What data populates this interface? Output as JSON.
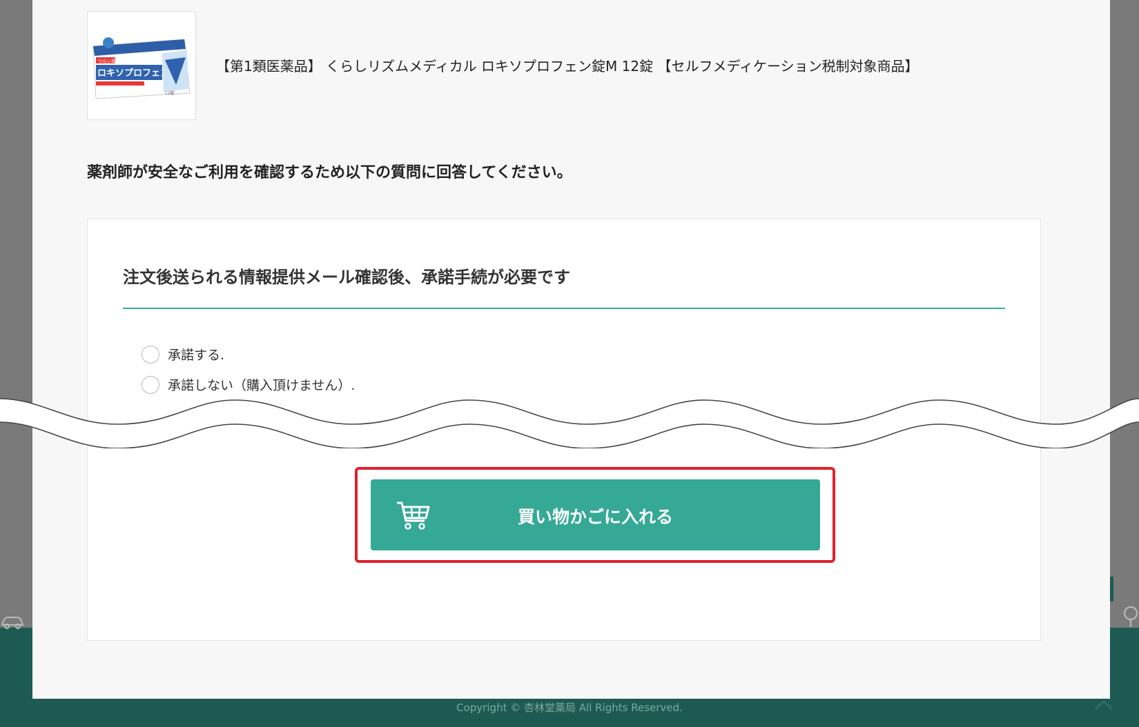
{
  "product": {
    "name": "【第1類医薬品】 くらしリズムメディカル ロキソプロフェン錠M 12錠 【セルフメディケーション税制対象商品】",
    "image_icon": "medicine-box-image",
    "package_text_top": "つらい痛みに",
    "package_text_main": "ロキソプロフェン錠M",
    "package_count": "12錠"
  },
  "instruction": "薬剤師が安全なご利用を確認するため以下の質問に回答してください。",
  "question": {
    "title": "注文後送られる情報提供メール確認後、承諾手続が必要です",
    "options": [
      {
        "label": "承諾する.",
        "selected": false
      },
      {
        "label": "承諾しない（購入頂けません）.",
        "selected": false
      }
    ]
  },
  "cart_button": {
    "label": "買い物かごに入れる",
    "icon": "shopping-cart-icon"
  },
  "footer": {
    "copyright": "Copyright © 杏林堂薬局 All Rights Reserved."
  },
  "colors": {
    "accent": "#35a996",
    "highlight": "#e0202c",
    "footer": "#1d5b52"
  }
}
